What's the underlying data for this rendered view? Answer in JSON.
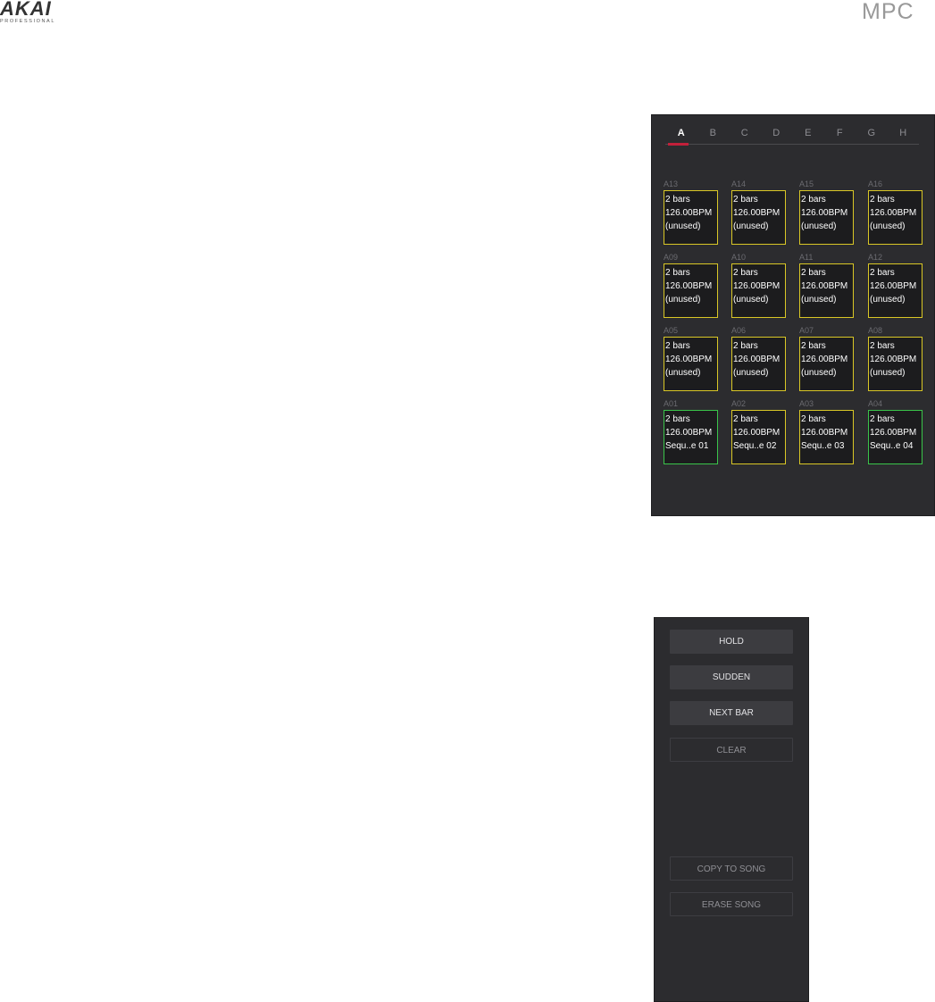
{
  "header": {
    "brand_main": "AKAI",
    "brand_sub": "PROFESSIONAL",
    "product": "MPC"
  },
  "bank_tabs": [
    "A",
    "B",
    "C",
    "D",
    "E",
    "F",
    "G",
    "H"
  ],
  "active_bank": "A",
  "pads": [
    {
      "id": "A13",
      "line1": "2 bars",
      "line2": "126.00BPM",
      "line3": "(unused)",
      "state": "unused"
    },
    {
      "id": "A14",
      "line1": "2 bars",
      "line2": "126.00BPM",
      "line3": "(unused)",
      "state": "unused"
    },
    {
      "id": "A15",
      "line1": "2 bars",
      "line2": "126.00BPM",
      "line3": "(unused)",
      "state": "unused"
    },
    {
      "id": "A16",
      "line1": "2 bars",
      "line2": "126.00BPM",
      "line3": "(unused)",
      "state": "unused"
    },
    {
      "id": "A09",
      "line1": "2 bars",
      "line2": "126.00BPM",
      "line3": "(unused)",
      "state": "unused"
    },
    {
      "id": "A10",
      "line1": "2 bars",
      "line2": "126.00BPM",
      "line3": "(unused)",
      "state": "unused"
    },
    {
      "id": "A11",
      "line1": "2 bars",
      "line2": "126.00BPM",
      "line3": "(unused)",
      "state": "unused"
    },
    {
      "id": "A12",
      "line1": "2 bars",
      "line2": "126.00BPM",
      "line3": "(unused)",
      "state": "unused"
    },
    {
      "id": "A05",
      "line1": "2 bars",
      "line2": "126.00BPM",
      "line3": "(unused)",
      "state": "unused"
    },
    {
      "id": "A06",
      "line1": "2 bars",
      "line2": "126.00BPM",
      "line3": "(unused)",
      "state": "unused"
    },
    {
      "id": "A07",
      "line1": "2 bars",
      "line2": "126.00BPM",
      "line3": "(unused)",
      "state": "unused"
    },
    {
      "id": "A08",
      "line1": "2 bars",
      "line2": "126.00BPM",
      "line3": "(unused)",
      "state": "unused"
    },
    {
      "id": "A01",
      "line1": "2 bars",
      "line2": "126.00BPM",
      "line3": "Sequ..e 01",
      "state": "playing"
    },
    {
      "id": "A02",
      "line1": "2 bars",
      "line2": "126.00BPM",
      "line3": "Sequ..e 02",
      "state": "loaded"
    },
    {
      "id": "A03",
      "line1": "2 bars",
      "line2": "126.00BPM",
      "line3": "Sequ..e 03",
      "state": "loaded"
    },
    {
      "id": "A04",
      "line1": "2 bars",
      "line2": "126.00BPM",
      "line3": "Sequ..e 04",
      "state": "playing"
    }
  ],
  "colors": {
    "panel_bg": "#2c2c2f",
    "pad_border_default": "#d9c726",
    "pad_border_active": "#3ac44a",
    "tab_underline": "#c2203a"
  },
  "options": {
    "hold": "HOLD",
    "sudden": "SUDDEN",
    "next_bar": "NEXT BAR",
    "clear": "CLEAR",
    "copy_to_song": "COPY TO SONG",
    "erase_song": "ERASE SONG"
  }
}
